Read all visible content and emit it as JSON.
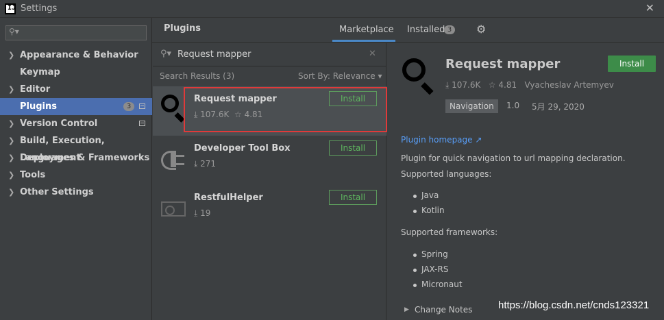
{
  "window": {
    "title": "Settings",
    "logo_text": "IJ"
  },
  "sidebar": {
    "search_placeholder": "",
    "items": [
      {
        "label": "Appearance & Behavior",
        "expandable": true
      },
      {
        "label": "Keymap",
        "expandable": false
      },
      {
        "label": "Editor",
        "expandable": true
      },
      {
        "label": "Plugins",
        "expandable": false,
        "selected": true,
        "badge": "3"
      },
      {
        "label": "Version Control",
        "expandable": true
      },
      {
        "label": "Build, Execution, Deployment",
        "expandable": true
      },
      {
        "label": "Languages & Frameworks",
        "expandable": true
      },
      {
        "label": "Tools",
        "expandable": true
      },
      {
        "label": "Other Settings",
        "expandable": true
      }
    ]
  },
  "header": {
    "title": "Plugins",
    "tabs": [
      {
        "label": "Marketplace",
        "active": true
      },
      {
        "label": "Installed",
        "badge": "3"
      }
    ]
  },
  "list": {
    "query": "Request mapper",
    "results_label": "Search Results (3)",
    "sort_label": "Sort By: Relevance",
    "plugins": [
      {
        "name": "Request mapper",
        "downloads": "107.6K",
        "rating": "4.81",
        "button": "Install",
        "icon": "magnifier-icon"
      },
      {
        "name": "Developer Tool Box",
        "downloads": "271",
        "button": "Install",
        "icon": "plug-icon"
      },
      {
        "name": "RestfulHelper",
        "downloads": "19",
        "button": "Install",
        "icon": "plugin-placeholder-icon"
      }
    ]
  },
  "details": {
    "name": "Request mapper",
    "install_label": "Install",
    "downloads": "107.6K",
    "rating": "4.81",
    "author": "Vyacheslav Artemyev",
    "tag": "Navigation",
    "version": "1.0",
    "date": "5月 29, 2020",
    "homepage_link": "Plugin homepage ↗",
    "description": "Plugin for quick navigation to url mapping declaration.",
    "languages_heading": "Supported languages:",
    "languages": [
      "Java",
      "Kotlin"
    ],
    "frameworks_heading": "Supported frameworks:",
    "frameworks": [
      "Spring",
      "JAX-RS",
      "Micronaut"
    ],
    "change_notes": "Change Notes"
  },
  "watermark": "https://blog.csdn.net/cnds123321",
  "colors": {
    "accent": "#4b6eaf",
    "install_green": "#3d8c49",
    "link": "#589df6",
    "highlight": "#e03a3a"
  }
}
